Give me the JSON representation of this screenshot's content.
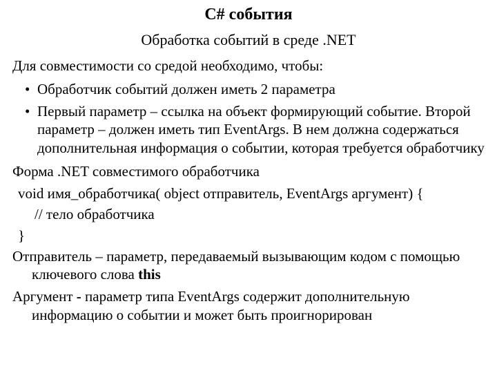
{
  "title": "C#    события",
  "subtitle": "Обработка событий в среде .NET",
  "lead": "Для совместимости со средой необходимо, чтобы:",
  "bullets": [
    "Обработчик событий должен иметь 2 параметра",
    "Первый параметр – ссылка на объект формирующий событие. Второй параметр – должен иметь тип EventArgs. В нем должна содержаться дополнительная информация о событии, которая требуется обработчику"
  ],
  "form_label": "Форма .NET совместимого обработчика",
  "code": {
    "line1": " void имя_обработчика( object отправитель, EventArgs аргумент) {",
    "line2": "// тело обработчика",
    "line3": "}"
  },
  "sender": {
    "prefix": "Отправитель – параметр, передаваемый вызывающим кодом с помощью ключевого слова ",
    "bold": "this"
  },
  "argument": {
    "prefix": "Аргумент ",
    "bold": "-",
    "rest": " параметр типа EventArgs содержит дополнительную информацию о событии и может быть проигнорирован"
  }
}
